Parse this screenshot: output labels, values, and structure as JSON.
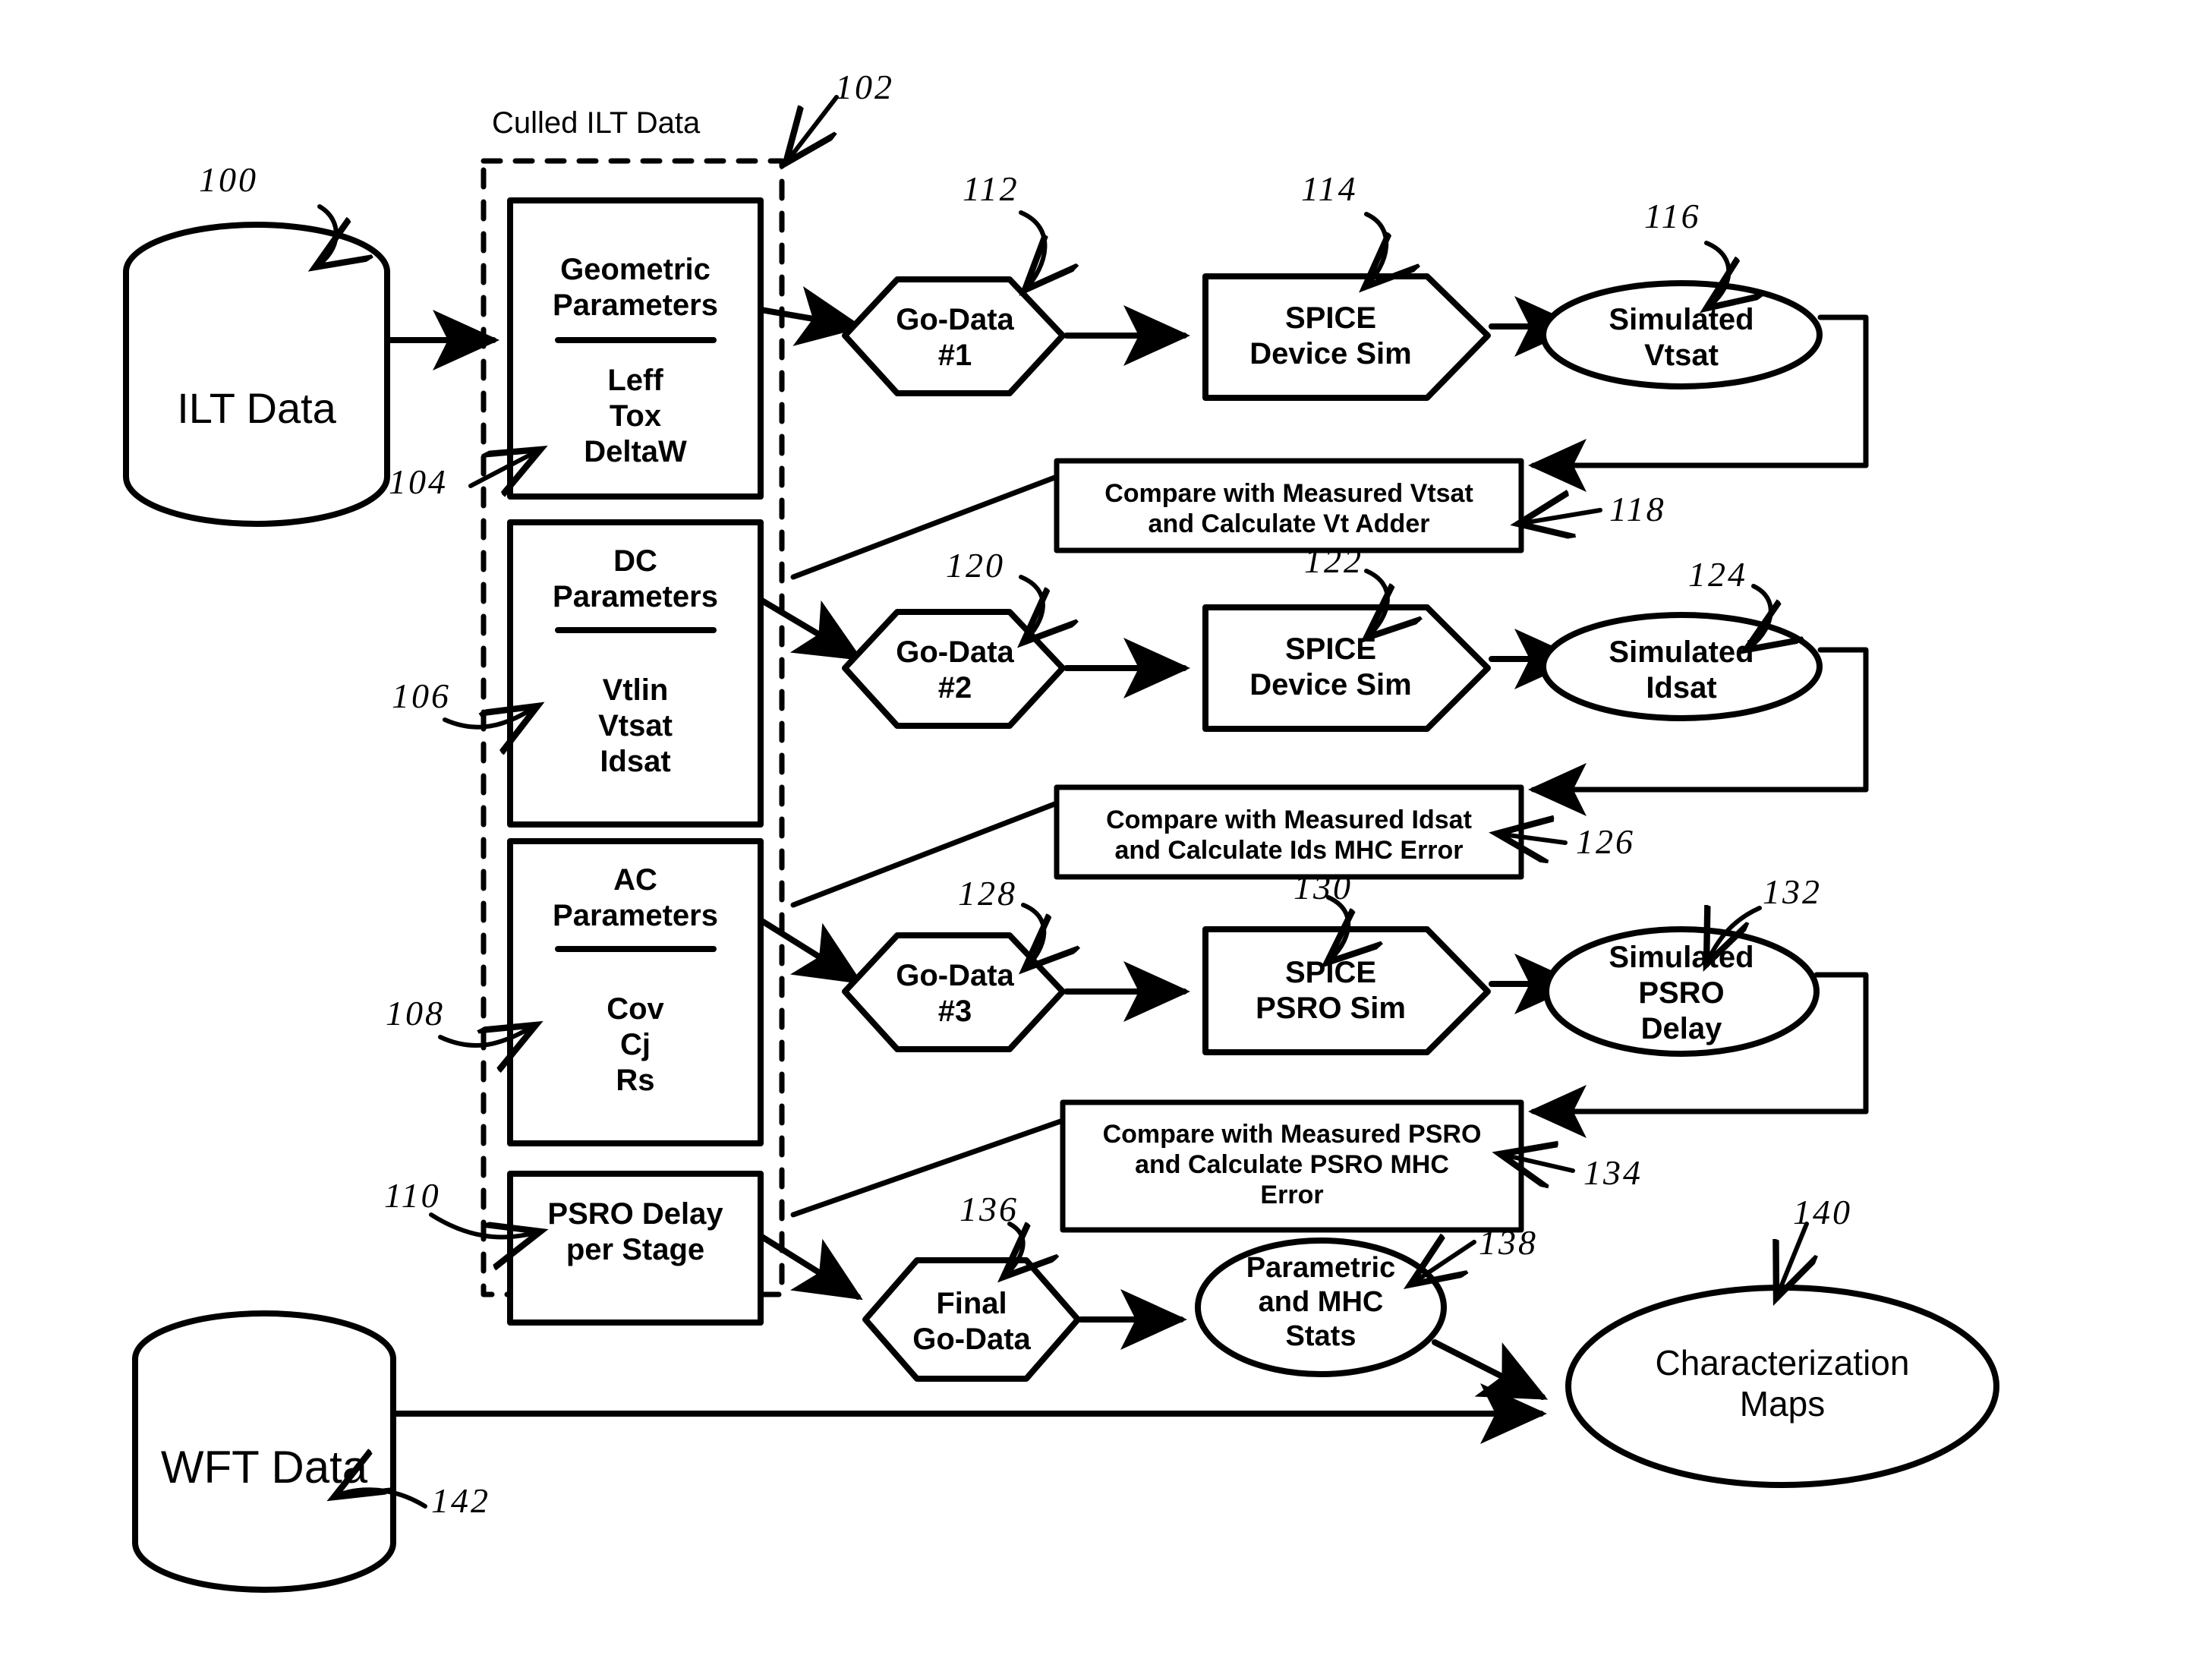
{
  "figure": {
    "title": "Culled ILT Data process flow",
    "line_color": "#000000",
    "background": "#ffffff"
  },
  "sources": {
    "ilt_database": {
      "label": "ILT Data",
      "ref": "100"
    },
    "wft_database": {
      "label": "WFT Data",
      "ref": "142"
    }
  },
  "culled_group": {
    "label": "Culled ILT Data",
    "ref": "102",
    "boxes": [
      {
        "title": "Geometric\nParameters",
        "items": "Leff\nTox\nDeltaW",
        "ref": "104"
      },
      {
        "title": "DC\nParameters",
        "items": "Vtlin\nVtsat\nIdsat",
        "ref": "106"
      },
      {
        "title": "AC\nParameters",
        "items": "Cov\nCj\nRs",
        "ref": "108"
      },
      {
        "title": "PSRO Delay\nper Stage",
        "items": "",
        "ref": "110"
      }
    ]
  },
  "rows": [
    {
      "godata": {
        "label": "Go-Data\n#1",
        "ref": "112"
      },
      "sim": {
        "label": "SPICE\nDevice Sim",
        "ref": "114"
      },
      "result": {
        "label": "Simulated\nVtsat",
        "ref": "116"
      },
      "compare": {
        "label": "Compare with Measured Vtsat\nand Calculate Vt Adder",
        "ref": "118"
      }
    },
    {
      "godata": {
        "label": "Go-Data\n#2",
        "ref": "120"
      },
      "sim": {
        "label": "SPICE\nDevice Sim",
        "ref": "122"
      },
      "result": {
        "label": "Simulated\nIdsat",
        "ref": "124"
      },
      "compare": {
        "label": "Compare with Measured Idsat\nand Calculate Ids MHC Error",
        "ref": "126"
      }
    },
    {
      "godata": {
        "label": "Go-Data\n#3",
        "ref": "128"
      },
      "sim": {
        "label": "SPICE\nPSRO Sim",
        "ref": "130"
      },
      "result": {
        "label": "Simulated\nPSRO\nDelay",
        "ref": "132"
      },
      "compare": {
        "label": "Compare with Measured PSRO\nand Calculate PSRO MHC\nError",
        "ref": "134"
      }
    }
  ],
  "final": {
    "godata": {
      "label": "Final\nGo-Data",
      "ref": "136"
    },
    "stats": {
      "label": "Parametric\nand MHC\nStats",
      "ref": "138"
    },
    "maps": {
      "label": "Characterization\nMaps",
      "ref": "140"
    }
  }
}
